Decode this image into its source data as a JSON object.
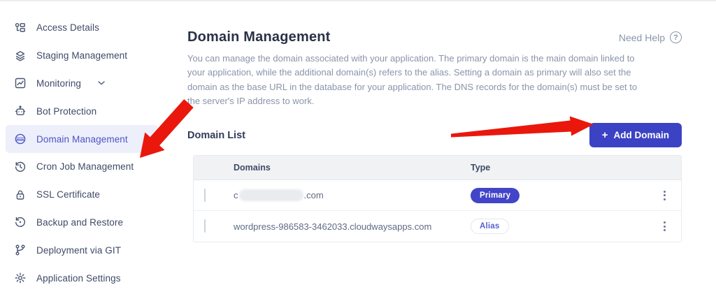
{
  "app": {
    "accent_color": "#4245c8",
    "active_item_bg": "#edeffa"
  },
  "sidebar": {
    "items": [
      {
        "label": "Access Details",
        "icon": "key-list-icon"
      },
      {
        "label": "Staging Management",
        "icon": "layers-icon"
      },
      {
        "label": "Monitoring",
        "icon": "chart-icon",
        "expandable": true
      },
      {
        "label": "Bot Protection",
        "icon": "robot-icon"
      },
      {
        "label": "Domain Management",
        "icon": "globe-www-icon",
        "active": true
      },
      {
        "label": "Cron Job Management",
        "icon": "clock-history-icon"
      },
      {
        "label": "SSL Certificate",
        "icon": "lock-icon"
      },
      {
        "label": "Backup and Restore",
        "icon": "restore-icon"
      },
      {
        "label": "Deployment via GIT",
        "icon": "git-branch-icon"
      },
      {
        "label": "Application Settings",
        "icon": "gear-icon"
      }
    ]
  },
  "main": {
    "title": "Domain Management",
    "need_help": {
      "label": "Need Help",
      "icon": "?"
    },
    "description": "You can manage the domain associated with your application. The primary domain is the main domain linked to your application, while the additional domain(s) refers to the alias. Setting a domain as primary will also set the domain as the base URL in the database for your application. The DNS records for the domain(s) must be set to the server's IP address to work.",
    "domain_list_label": "Domain List",
    "add_domain_button": {
      "icon": "+",
      "label": "Add Domain"
    },
    "table": {
      "headers": [
        "Domains",
        "Type"
      ],
      "rows": [
        {
          "domain_prefix": "c",
          "domain_redacted": true,
          "domain_suffix": ".com",
          "type": "Primary"
        },
        {
          "domain": "wordpress-986583-3462033.cloudwaysapps.com",
          "type": "Alias"
        }
      ]
    }
  },
  "annotations": {
    "color": "#ea170c",
    "arrows": [
      {
        "points_to": "sidebar-item-domain-management",
        "direction": "down-left"
      },
      {
        "points_to": "add-domain-button",
        "direction": "right"
      }
    ]
  }
}
